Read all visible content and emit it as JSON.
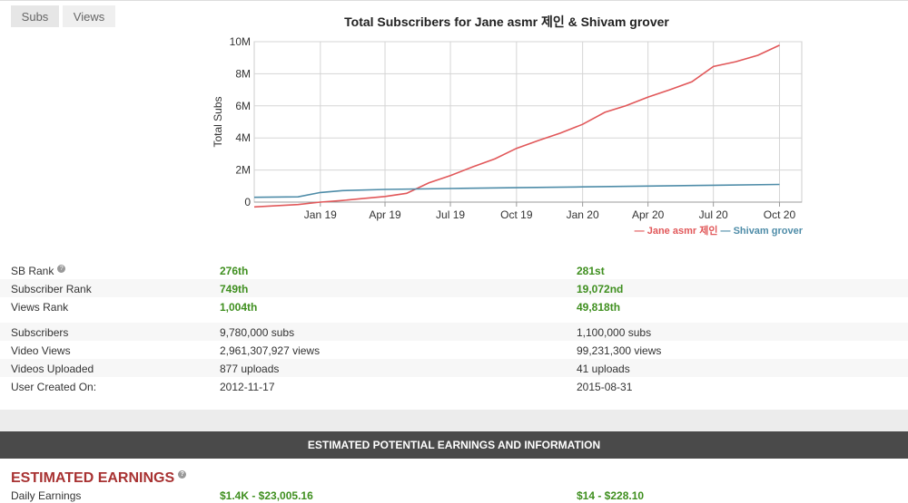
{
  "tabs": [
    {
      "label": "Subs"
    },
    {
      "label": "Views"
    }
  ],
  "chart_data": {
    "type": "line",
    "title": "Total Subscribers for Jane asmr 제인 & Shivam grover",
    "ylabel": "Total Subs",
    "xlabel": "",
    "ylim": [
      0,
      10000000
    ],
    "yticks": [
      0,
      2000000,
      4000000,
      6000000,
      8000000,
      10000000
    ],
    "ytick_labels": [
      "0",
      "2M",
      "4M",
      "6M",
      "8M",
      "10M"
    ],
    "xticks": [
      "2019-01",
      "2019-04",
      "2019-07",
      "2019-10",
      "2020-01",
      "2020-04",
      "2020-07",
      "2020-10"
    ],
    "xtick_labels": [
      "Jan 19",
      "Apr 19",
      "Jul 19",
      "Oct 19",
      "Jan 20",
      "Apr 20",
      "Jul 20",
      "Oct 20"
    ],
    "grid": true,
    "legend_position": "bottom-right",
    "series": [
      {
        "name": "Jane asmr 제인",
        "color": "#e15759",
        "x": [
          "2018-10",
          "2018-12",
          "2019-01",
          "2019-02",
          "2019-03",
          "2019-04",
          "2019-05",
          "2019-06",
          "2019-07",
          "2019-08",
          "2019-09",
          "2019-10",
          "2019-11",
          "2019-12",
          "2020-01",
          "2020-02",
          "2020-03",
          "2020-04",
          "2020-05",
          "2020-06",
          "2020-07",
          "2020-08",
          "2020-09",
          "2020-10"
        ],
        "values": [
          -300000,
          -150000,
          0,
          100000,
          220000,
          350000,
          550000,
          1200000,
          1650000,
          2200000,
          2700000,
          3350000,
          3850000,
          4300000,
          4850000,
          5600000,
          6000000,
          6550000,
          7000000,
          7500000,
          8450000,
          8750000,
          9150000,
          9780000
        ]
      },
      {
        "name": "Shivam grover",
        "color": "#4e8ca8",
        "x": [
          "2018-10",
          "2018-12",
          "2019-01",
          "2019-02",
          "2019-04",
          "2019-07",
          "2019-10",
          "2020-01",
          "2020-04",
          "2020-07",
          "2020-10"
        ],
        "values": [
          300000,
          330000,
          600000,
          720000,
          790000,
          850000,
          900000,
          950000,
          1000000,
          1050000,
          1100000
        ]
      }
    ]
  },
  "stats": [
    {
      "label": "SB Rank",
      "help": "?",
      "v1": "276th",
      "v2": "281st",
      "green": true
    },
    {
      "label": "Subscriber Rank",
      "v1": "749th",
      "v2": "19,072nd",
      "green": true
    },
    {
      "label": "Views Rank",
      "v1": "1,004th",
      "v2": "49,818th",
      "green": true
    },
    {
      "label": "Subscribers",
      "v1": "9,780,000 subs",
      "v2": "1,100,000 subs",
      "green": false
    },
    {
      "label": "Video Views",
      "v1": "2,961,307,927 views",
      "v2": "99,231,300 views",
      "green": false
    },
    {
      "label": "Videos Uploaded",
      "v1": "877 uploads",
      "v2": "41 uploads",
      "green": false
    },
    {
      "label": "User Created On:",
      "v1": "2012-11-17",
      "v2": "2015-08-31",
      "green": false
    }
  ],
  "section_bar": "ESTIMATED POTENTIAL EARNINGS AND INFORMATION",
  "earnings": {
    "title": "ESTIMATED EARNINGS",
    "help": "?",
    "daily": {
      "label": "Daily Earnings",
      "v1": "$1.4K - $23,005.16",
      "v2": "$14 - $228.10"
    }
  }
}
